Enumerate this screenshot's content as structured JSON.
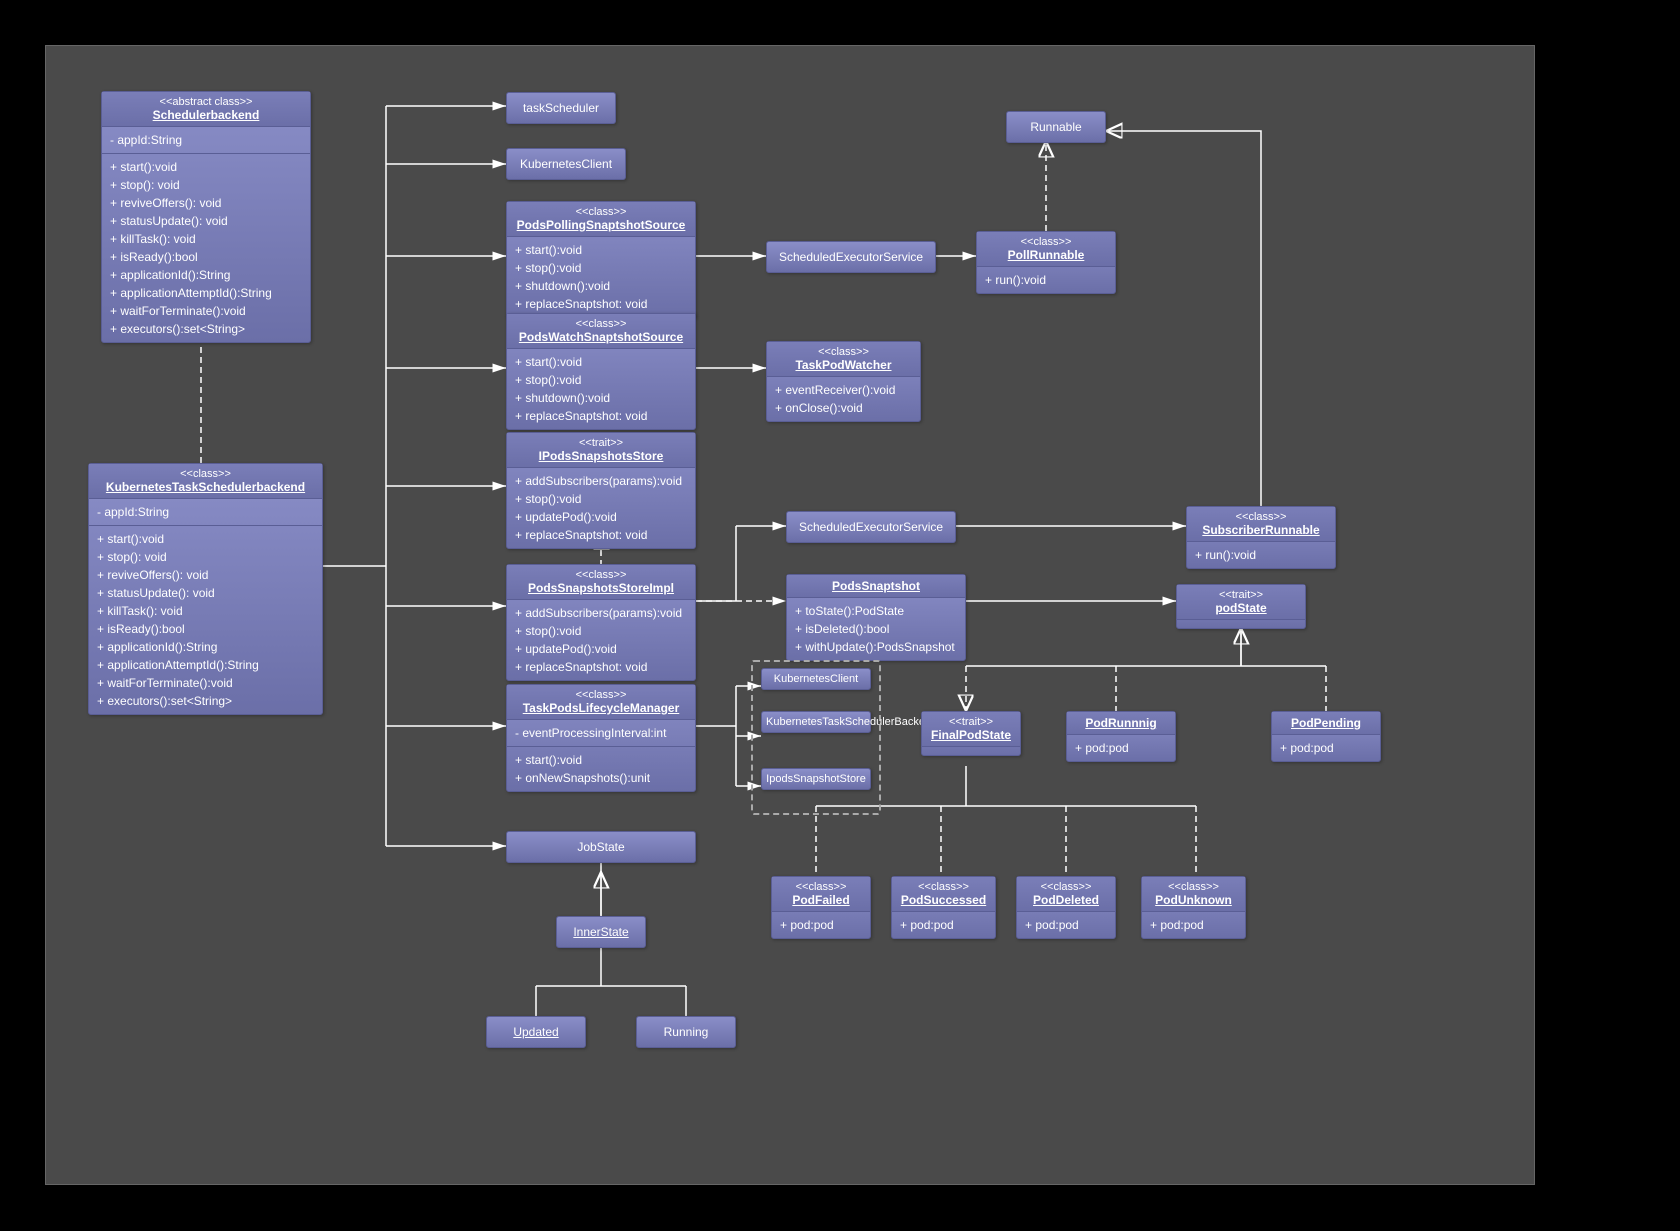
{
  "schedulerBackend": {
    "stereo": "<<abstract class>>",
    "name": "Schedulerbackend",
    "attrs": "- appId:String",
    "methods": "+ start():void\n+ stop(): void\n+ reviveOffers(): void\n+ statusUpdate(): void\n+ killTask(): void\n+ isReady():bool\n+ applicationId():String\n+ applicationAttemptId():String\n+ waitForTerminate():void\n+ executors():set<String>"
  },
  "kubernetesTaskScheduler": {
    "stereo": "<<class>>",
    "name": "KubernetesTaskSchedulerbackend",
    "attrs": "- appId:String",
    "methods": "+ start():void\n+ stop(): void\n+ reviveOffers(): void\n+ statusUpdate(): void\n+ killTask(): void\n+ isReady():bool\n+ applicationId():String\n+ applicationAttemptId():String\n+ waitForTerminate():void\n+ executors():set<String>"
  },
  "taskScheduler": {
    "label": "taskScheduler"
  },
  "kubernetesClient1": {
    "label": "KubernetesClient"
  },
  "podsPollingSnapshotSource": {
    "stereo": "<<class>>",
    "name": "PodsPollingSnaptshotSource",
    "methods": "+ start():void\n+ stop():void\n+ shutdown():void\n+ replaceSnaptshot: void"
  },
  "scheduledExecutorService1": {
    "label": "ScheduledExecutorService"
  },
  "runnable": {
    "label": "Runnable"
  },
  "pollRunnable": {
    "stereo": "<<class>>",
    "name": "PollRunnable",
    "methods": "+ run():void"
  },
  "podsWatchSnapshotSource": {
    "stereo": "<<class>>",
    "name": "PodsWatchSnaptshotSource",
    "methods": "+ start():void\n+ stop():void\n+ shutdown():void\n+ replaceSnaptshot: void"
  },
  "taskPodWatcher": {
    "stereo": "<<class>>",
    "name": "TaskPodWatcher",
    "methods": "+ eventReceiver():void\n+ onClose():void"
  },
  "ipodsSnapshotsStore": {
    "stereo": "<<trait>>",
    "name": "IPodsSnapshotsStore",
    "methods": "+ addSubscribers(params):void\n+ stop():void\n+ updatePod():void\n+ replaceSnaptshot: void"
  },
  "scheduledExecutorService2": {
    "label": "ScheduledExecutorService"
  },
  "subscriberRunnable": {
    "stereo": "<<class>>",
    "name": "SubscriberRunnable",
    "methods": "+ run():void"
  },
  "podsSnapshotsStoreImpl": {
    "stereo": "<<class>>",
    "name": "PodsSnapshotsStoreImpl",
    "methods": "+ addSubscribers(params):void\n+ stop():void\n+ updatePod():void\n+ replaceSnaptshot: void"
  },
  "podsSnapshot": {
    "name": "PodsSnaptshot",
    "methods": "+ toState():PodState\n+ isDeleted():bool\n+ withUpdate():PodsSnapshot"
  },
  "podState": {
    "stereo": "<<trait>>",
    "name": "podState"
  },
  "taskPodsLifecycleManager": {
    "stereo": "<<class>>",
    "name": "TaskPodsLifecycleManager",
    "attrs": "- eventProcessingInterval:int",
    "methods": "+ start():void\n+ onNewSnapshots():unit"
  },
  "kubernetesClient2": {
    "label": "KubernetesClient"
  },
  "kubernetesTaskSchedulerBackend2": {
    "label": "KubernetesTaskSchedulerBackend"
  },
  "ipodsSnapshotStore2": {
    "label": "IpodsSnapshotStore"
  },
  "finalPodState": {
    "stereo": "<<trait>>",
    "name": "FinalPodState"
  },
  "podRunning": {
    "name": "PodRunnnig",
    "methods": "+ pod:pod"
  },
  "podPending": {
    "name": "PodPending",
    "methods": "+ pod:pod"
  },
  "jobState": {
    "label": "JobState"
  },
  "innerState": {
    "label": "InnerState"
  },
  "updated": {
    "label": "Updated"
  },
  "running": {
    "label": "Running"
  },
  "podFailed": {
    "stereo": "<<class>>",
    "name": "PodFailed",
    "methods": "+ pod:pod"
  },
  "podSuccessed": {
    "stereo": "<<class>>",
    "name": "PodSuccessed",
    "methods": "+ pod:pod"
  },
  "podDeleted": {
    "stereo": "<<class>>",
    "name": "PodDeleted",
    "methods": "+ pod:pod"
  },
  "podUnknown": {
    "stereo": "<<class>>",
    "name": "PodUnknown",
    "methods": "+ pod:pod"
  }
}
